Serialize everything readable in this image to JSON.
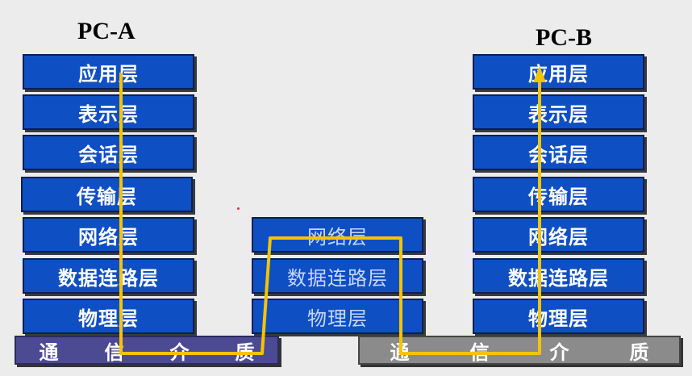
{
  "pc_a": {
    "title": "PC-A",
    "layers": [
      "应用层",
      "表示层",
      "会话层",
      "传输层",
      "网络层",
      "数据连路层",
      "物理层"
    ]
  },
  "pc_b": {
    "title": "PC-B",
    "layers": [
      "应用层",
      "表示层",
      "会话层",
      "传输层",
      "网络层",
      "数据连路层",
      "物理层"
    ]
  },
  "router": {
    "layers": [
      "网络层",
      "数据连路层",
      "物理层"
    ]
  },
  "medium": {
    "left_chars": [
      "通",
      "信",
      "介",
      "质"
    ],
    "right_chars": [
      "通",
      "信",
      "介",
      "质"
    ]
  },
  "colors": {
    "layer_fill": "#0f4fc4",
    "path": "#f5c400",
    "medium_left": "#4d4a94",
    "medium_right": "#8b8b8b"
  }
}
